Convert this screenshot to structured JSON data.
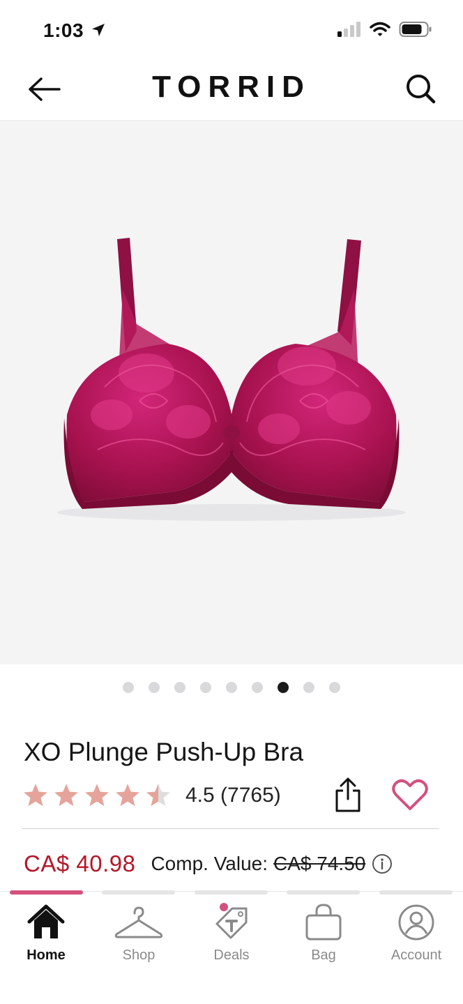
{
  "status_bar": {
    "time": "1:03"
  },
  "header": {
    "brand": "TORRID"
  },
  "gallery": {
    "image_count": 9,
    "active_index": 6
  },
  "product": {
    "title": "XO Plunge Push-Up Bra",
    "rating_value": 4.5,
    "rating_text": "4.5 (7765)",
    "price": "CA$ 40.98",
    "comp_label": "Comp. Value:",
    "comp_price": "CA$ 74.50"
  },
  "tabs": [
    {
      "label": "Home",
      "icon": "home-icon",
      "active": true
    },
    {
      "label": "Shop",
      "icon": "hanger-icon",
      "active": false
    },
    {
      "label": "Deals",
      "icon": "tag-icon",
      "active": false
    },
    {
      "label": "Bag",
      "icon": "bag-icon",
      "active": false
    },
    {
      "label": "Account",
      "icon": "account-icon",
      "active": false
    }
  ],
  "colors": {
    "accent": "#d4517c",
    "price": "#b3182a",
    "star": "#e5a49b",
    "product": "#9b1147"
  }
}
